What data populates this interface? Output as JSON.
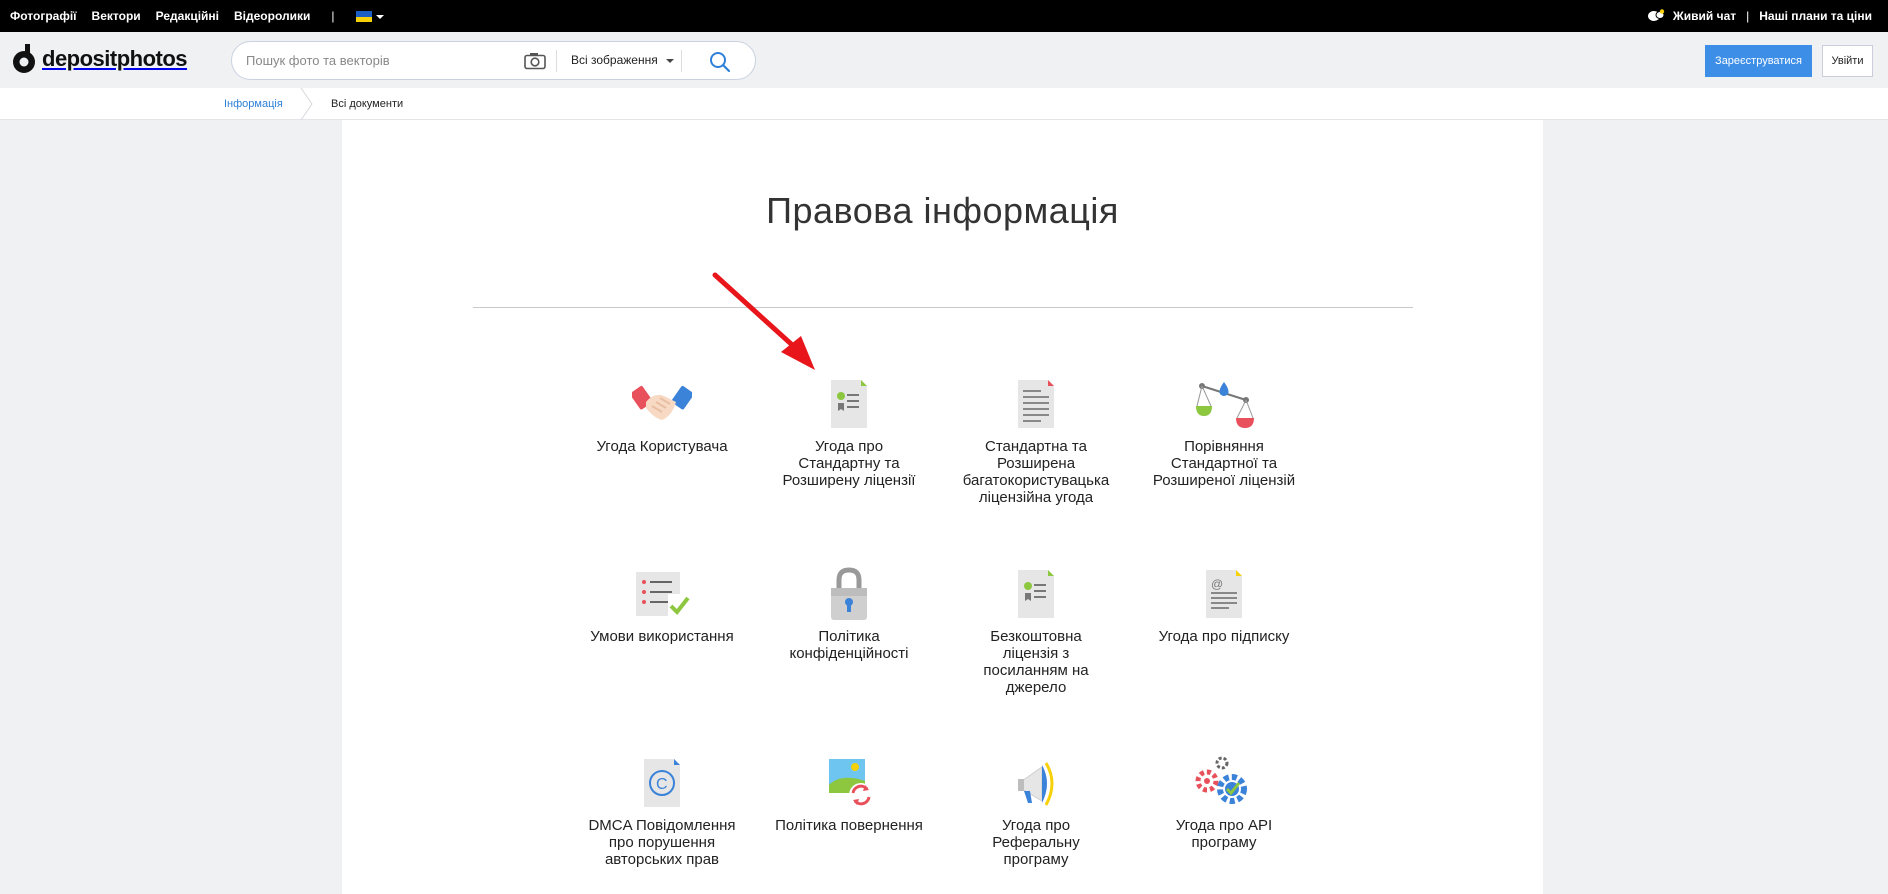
{
  "topbar": {
    "nav": [
      "Фотографії",
      "Вектори",
      "Редакційні",
      "Відеоролики"
    ],
    "language_flag": "ukraine-flag",
    "live_chat": "Живий чат",
    "plans": "Наші плани та ціни"
  },
  "header": {
    "logo_text": "depositphotos",
    "search_placeholder": "Пошук фото та векторів",
    "filter_label": "Всі зображення",
    "register_label": "Зареєструватися",
    "login_label": "Увійти"
  },
  "breadcrumb": {
    "parent": "Інформація",
    "current": "Всі документи"
  },
  "page": {
    "title": "Правова інформація"
  },
  "documents": [
    {
      "label": "Угода Користувача",
      "icon": "handshake-icon"
    },
    {
      "label": "Угода про Стандартну та Розширену ліцензії",
      "icon": "license-document-icon"
    },
    {
      "label": "Стандартна та Розширена багатокористувацька ліцензійна угода",
      "icon": "text-document-icon"
    },
    {
      "label": "Порівняння Стандартної та Розширеної ліцензій",
      "icon": "scales-icon"
    },
    {
      "label": "Умови використання",
      "icon": "checklist-icon"
    },
    {
      "label": "Політика конфіденційності",
      "icon": "padlock-icon"
    },
    {
      "label": "Безкоштовна ліцензія з посиланням на джерело",
      "icon": "license-document-icon"
    },
    {
      "label": "Угода про підписку",
      "icon": "email-document-icon"
    },
    {
      "label": "DMCA Повідомлення про порушення авторських прав",
      "icon": "copyright-document-icon"
    },
    {
      "label": "Політика повернення",
      "icon": "image-refund-icon"
    },
    {
      "label": "Угода про Реферальну програму",
      "icon": "megaphone-icon"
    },
    {
      "label": "Угода про API програму",
      "icon": "gears-icon"
    }
  ],
  "colors": {
    "accent_blue": "#3d8ee6",
    "annotation_arrow": "#e8161b"
  }
}
